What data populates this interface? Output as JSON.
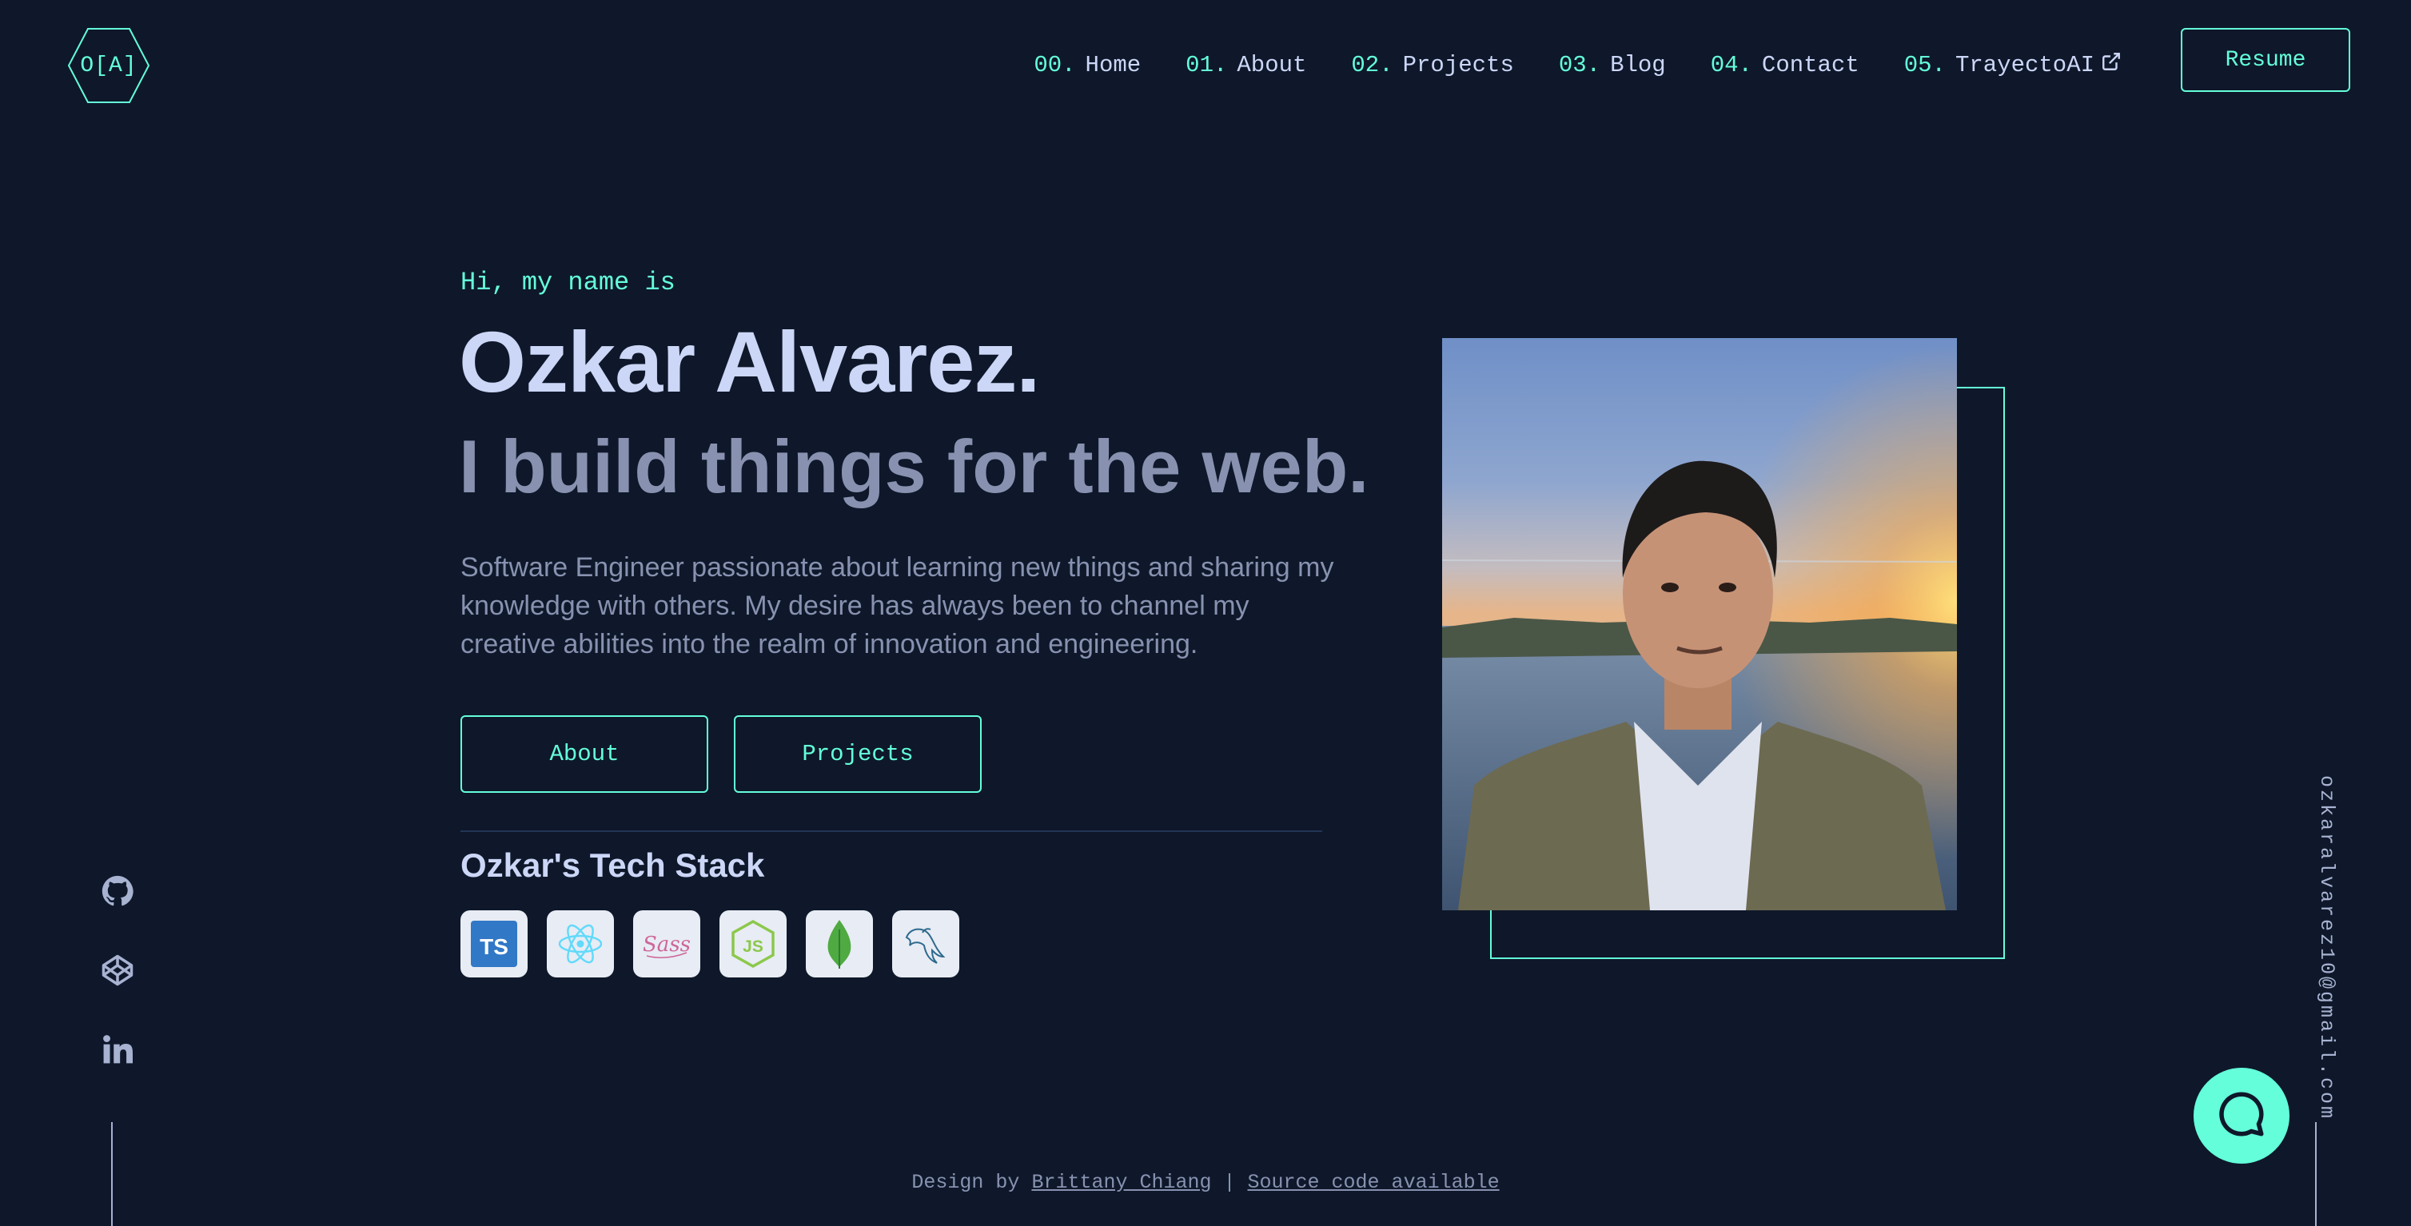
{
  "header": {
    "logo_text": "O[A]",
    "nav": [
      {
        "num": "00.",
        "label": "Home"
      },
      {
        "num": "01.",
        "label": "About"
      },
      {
        "num": "02.",
        "label": "Projects"
      },
      {
        "num": "03.",
        "label": "Blog"
      },
      {
        "num": "04.",
        "label": "Contact"
      },
      {
        "num": "05.",
        "label": "TrayectoAI",
        "icon": "external-link-icon"
      }
    ],
    "resume_label": "Resume"
  },
  "hero": {
    "greeting": "Hi, my name is",
    "name": "Ozkar Alvarez.",
    "tagline": "I build things for the web.",
    "bio": "Software Engineer passionate about learning new things and sharing my knowledge with others. My desire has always been to channel my creative abilities into the realm of innovation and engineering.",
    "about_label": "About",
    "projects_label": "Projects",
    "stack_title": "Ozkar's Tech Stack",
    "stack": [
      "typescript-icon",
      "react-icon",
      "sass-icon",
      "nodejs-icon",
      "mongodb-icon",
      "mysql-icon"
    ]
  },
  "social": [
    "github-icon",
    "codepen-icon",
    "linkedin-icon"
  ],
  "email": "ozkaralvarez10@gmail.com",
  "footer": {
    "prefix": "Design by",
    "designer": "Brittany Chiang",
    "separator": "|",
    "source": "Source code available"
  },
  "colors": {
    "background": "#0e182a",
    "accent": "#64ffda",
    "heading": "#ccd6f6",
    "text": "#8892b0"
  }
}
